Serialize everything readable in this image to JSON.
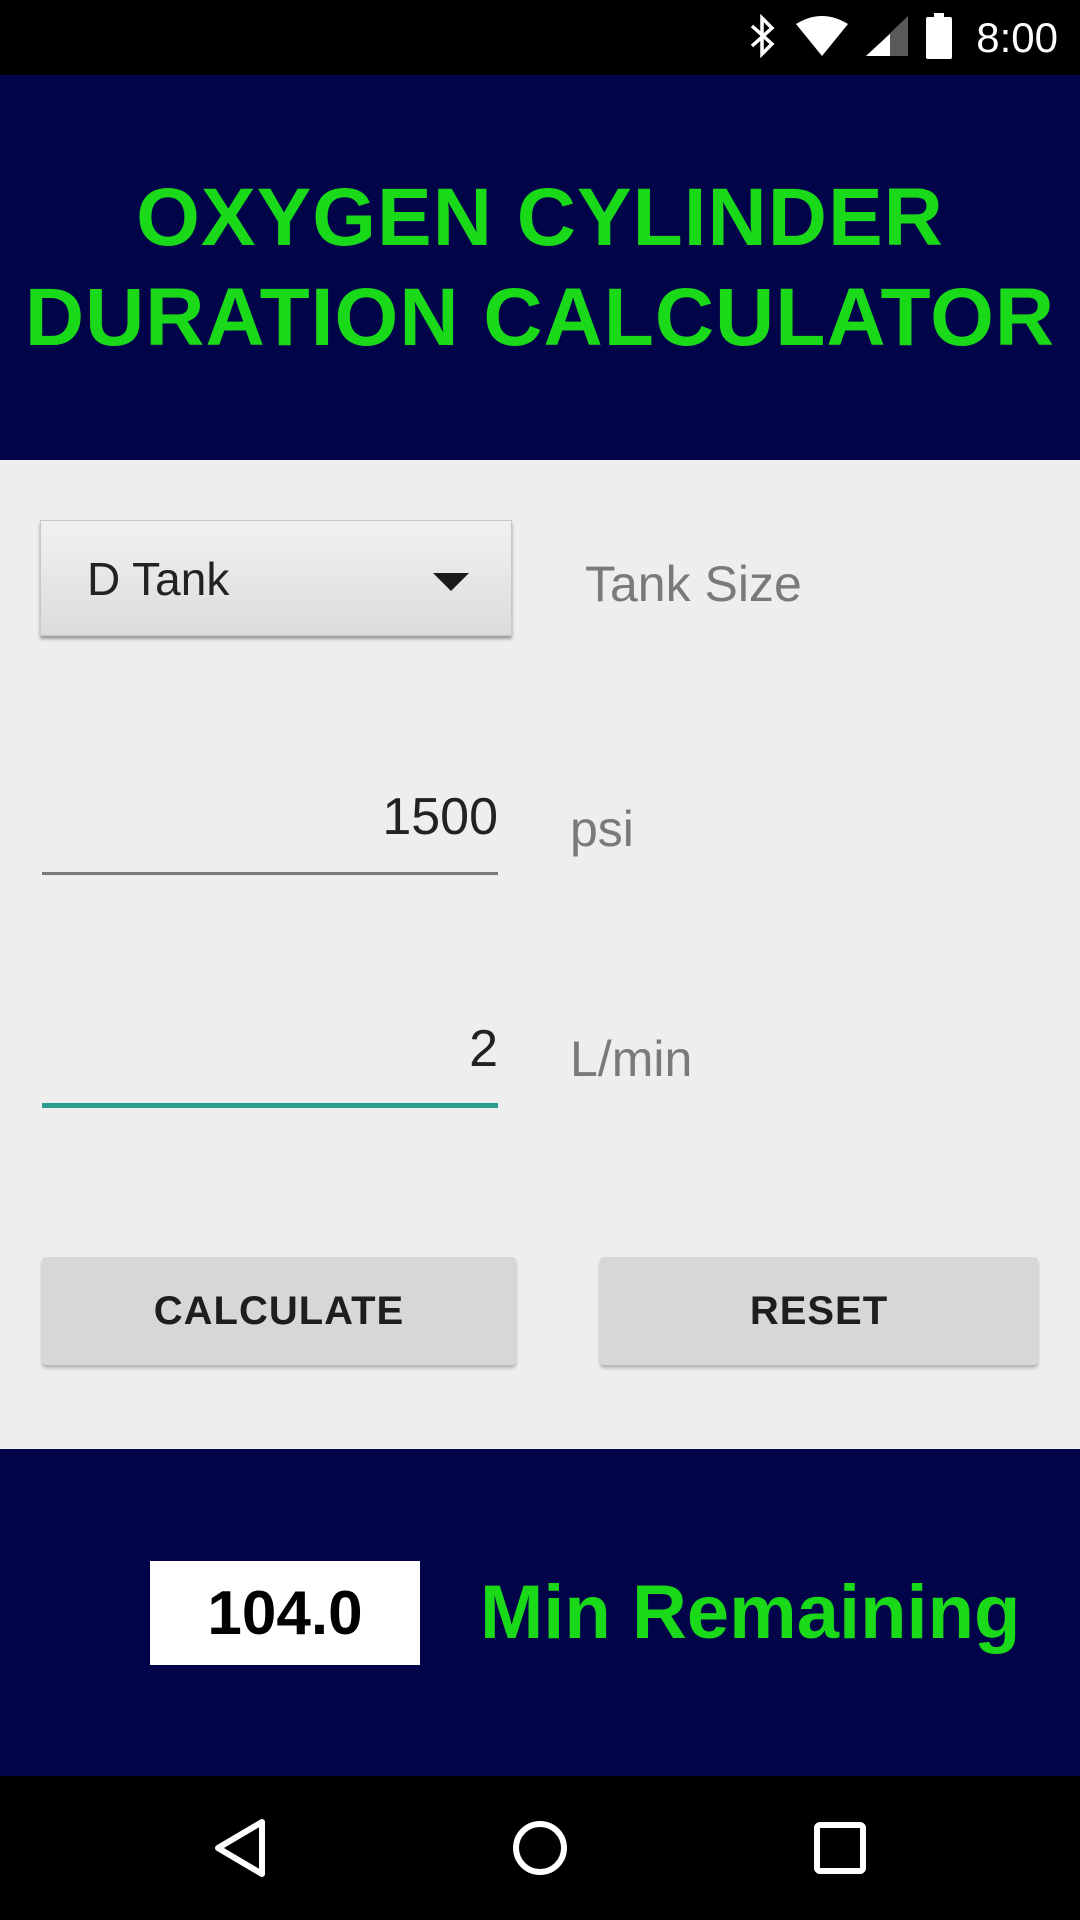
{
  "status_bar": {
    "time": "8:00",
    "icons": [
      "bluetooth-icon",
      "wifi-icon",
      "cell-signal-icon",
      "battery-icon"
    ]
  },
  "header": {
    "title_line1": "OXYGEN CYLINDER",
    "title_line2": "DURATION CALCULATOR",
    "background_color": "#02044a",
    "title_color": "#19d918"
  },
  "form": {
    "tank_select": {
      "selected": "D Tank",
      "label": "Tank Size"
    },
    "pressure": {
      "value": "1500",
      "unit": "psi"
    },
    "flow": {
      "value": "2",
      "unit": "L/min"
    },
    "calculate_label": "CALCULATE",
    "reset_label": "RESET"
  },
  "result": {
    "value": "104.0",
    "label": "Min Remaining"
  },
  "nav_bar": {
    "icons": [
      "back-icon",
      "home-icon",
      "recents-icon"
    ]
  },
  "colors": {
    "accent_green": "#19d918",
    "navy": "#02044a",
    "focus_underline": "#2a9d8f"
  }
}
